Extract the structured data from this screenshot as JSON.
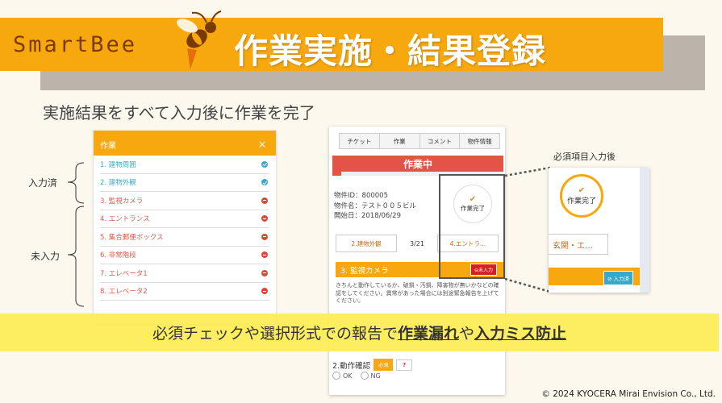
{
  "banner": {
    "logo": "SmartBee",
    "title": "作業実施・結果登録"
  },
  "subtitle": "実施結果をすべて入力後に作業を完了",
  "task_panel": {
    "header": "作業",
    "close": "×",
    "items": [
      {
        "label": "1.  建物周囲",
        "status": "done"
      },
      {
        "label": "2.  建物外観",
        "status": "done"
      },
      {
        "label": "3.  監視カメラ",
        "status": "todo"
      },
      {
        "label": "4.  エントランス",
        "status": "todo"
      },
      {
        "label": "5.  集合郵便ボックス",
        "status": "todo"
      },
      {
        "label": "6.  非常階段",
        "status": "todo"
      },
      {
        "label": "7.  エレベータ1",
        "status": "todo"
      },
      {
        "label": "8.  エレベータ2",
        "status": "todo"
      }
    ]
  },
  "labels": {
    "entered": "入力済",
    "not_entered": "未入力"
  },
  "phone": {
    "tabs": [
      "チケット",
      "作業",
      "コメント",
      "物件情報"
    ],
    "status": "作業中",
    "progress_fraction": 0.05,
    "info": [
      "物件ID：800005",
      "物件名：テスト００５ビル",
      "開始日：2018/06/29"
    ],
    "stamp": "作業完了",
    "nav_prev": "2.建物外観",
    "nav_page": "3/21",
    "nav_next": "4.エントラ…",
    "section": "3.  監視カメラ",
    "section_badge": "⊖未入力",
    "description": "きちんと動作しているか、破損・汚損、障害物が無いかなどの確認をしてください。異常があった場合には別途緊急報告を上げてください。",
    "q2_label": "2.動作確認",
    "q2_required": "必須",
    "q2_help": "?",
    "radio_ok": "OK",
    "radio_ng": "NG"
  },
  "zoom": {
    "label": "必須項目入力後",
    "stamp": "作業完了",
    "nav": "玄関・エ…",
    "badge": "⊘ 入力済"
  },
  "caption": {
    "part1": "必須チェックや選択形式での報告で",
    "part2": "作業漏れ",
    "part3": "や",
    "part4": "入力ミス防止"
  },
  "copyright": "© 2024 KYOCERA Mirai Envision Co., Ltd.",
  "colors": {
    "accent": "#f7a80e",
    "status_red": "#e35447",
    "done_blue": "#3aa8c9",
    "caption_yellow": "#fdec55"
  }
}
